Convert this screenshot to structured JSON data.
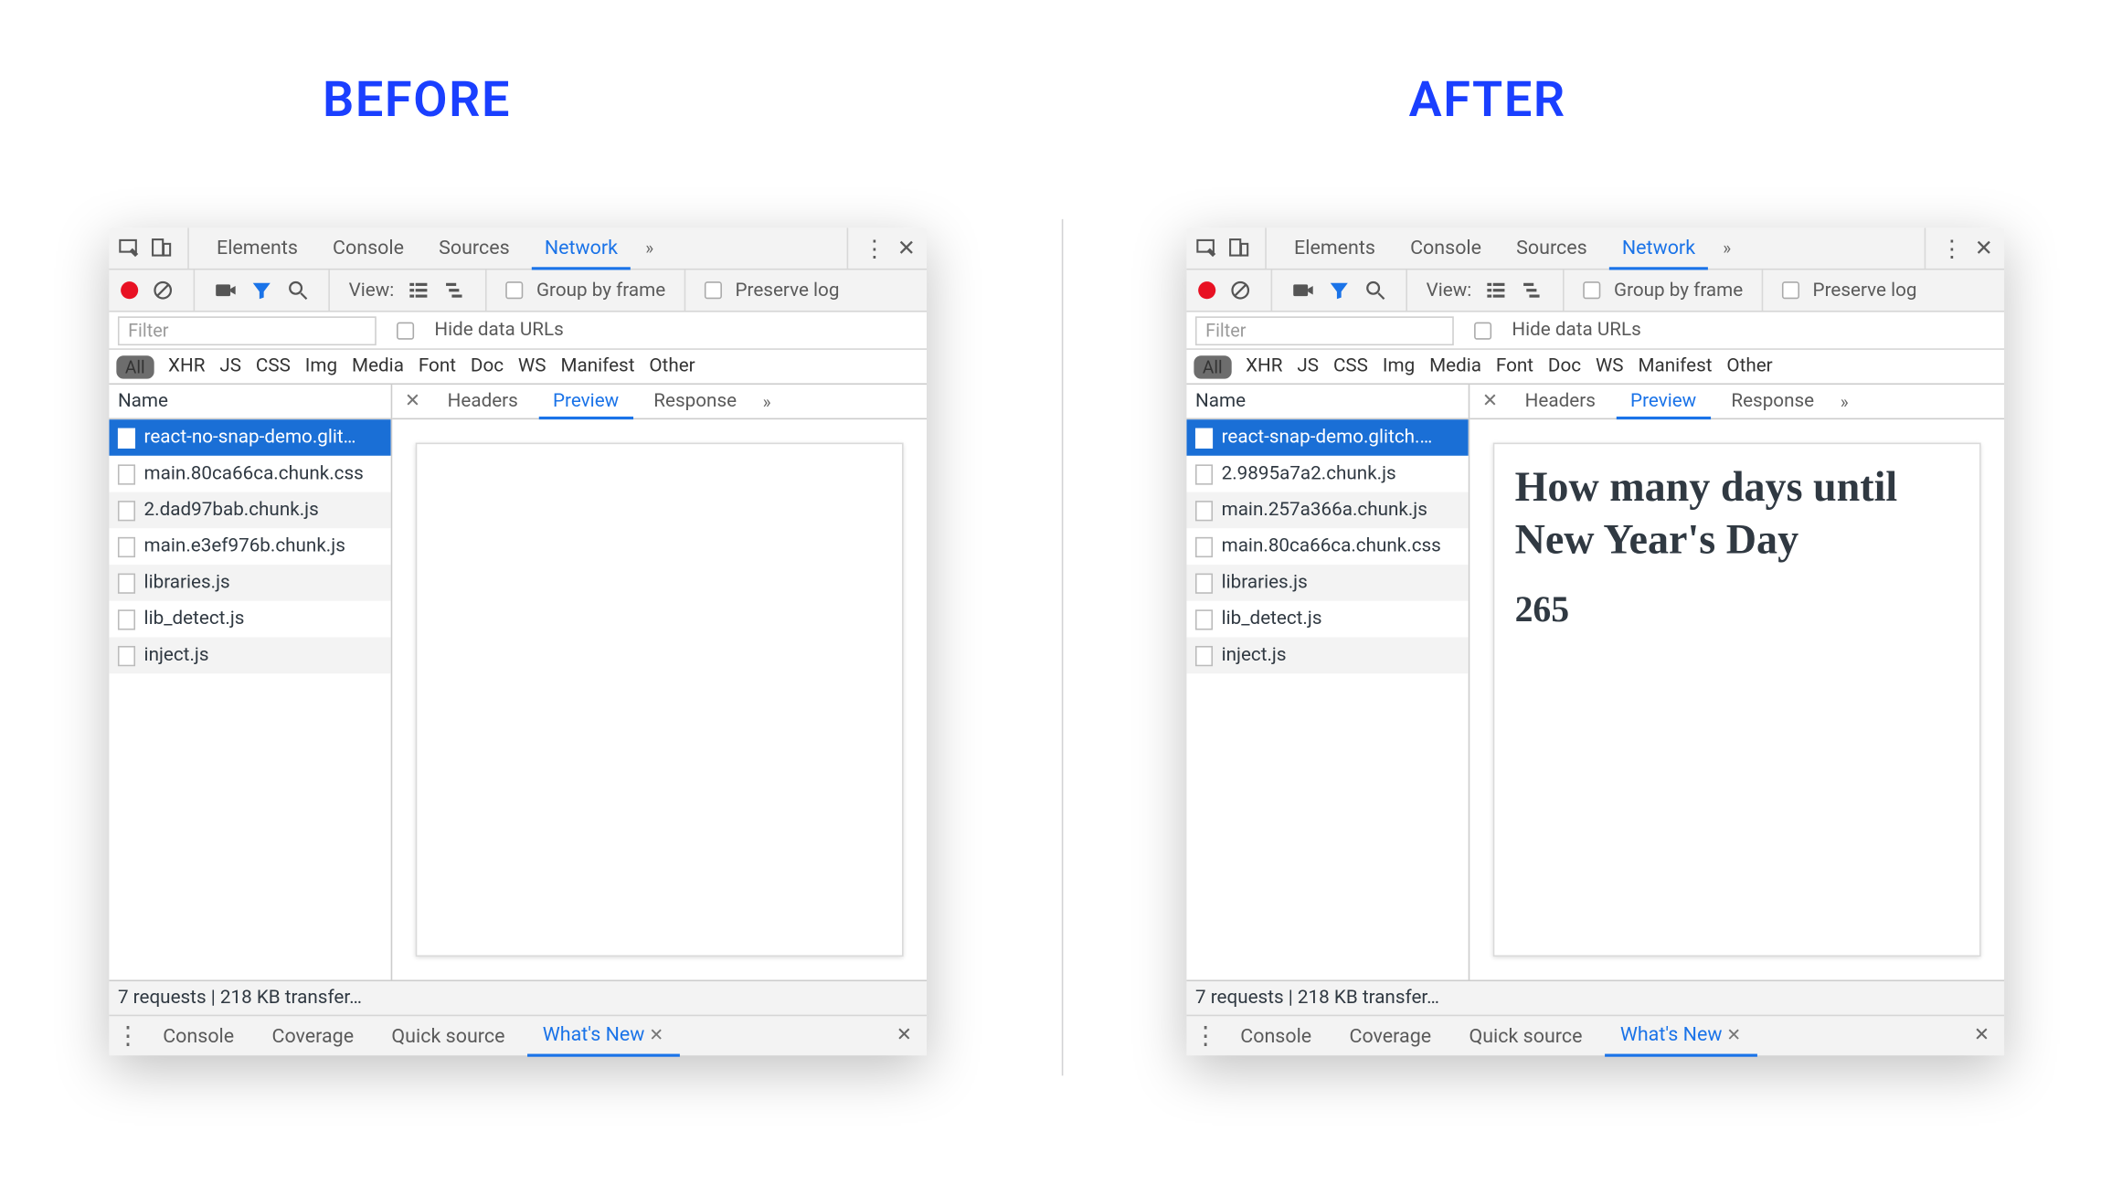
{
  "labels": {
    "before": "BEFORE",
    "after": "AFTER"
  },
  "devtools": {
    "topTabs": {
      "elements": "Elements",
      "console": "Console",
      "sources": "Sources",
      "network": "Network"
    },
    "toolbar": {
      "viewLabel": "View:",
      "groupByFrame": "Group by frame",
      "preserveLog": "Preserve log"
    },
    "filter": {
      "placeholder": "Filter",
      "hideDataUrls": "Hide data URLs"
    },
    "typeFilters": {
      "all": "All",
      "xhr": "XHR",
      "js": "JS",
      "css": "CSS",
      "img": "Img",
      "media": "Media",
      "font": "Font",
      "doc": "Doc",
      "ws": "WS",
      "manifest": "Manifest",
      "other": "Other"
    },
    "listHeader": "Name",
    "detailTabs": {
      "headers": "Headers",
      "preview": "Preview",
      "response": "Response"
    },
    "status": "7 requests | 218 KB transfer…",
    "drawerTabs": {
      "console": "Console",
      "coverage": "Coverage",
      "quick": "Quick source",
      "whatsnew": "What's New"
    }
  },
  "before": {
    "requests": [
      "react-no-snap-demo.glit…",
      "main.80ca66ca.chunk.css",
      "2.dad97bab.chunk.js",
      "main.e3ef976b.chunk.js",
      "libraries.js",
      "lib_detect.js",
      "inject.js"
    ],
    "preview": {
      "heading": "",
      "count": ""
    }
  },
  "after": {
    "requests": [
      "react-snap-demo.glitch.…",
      "2.9895a7a2.chunk.js",
      "main.257a366a.chunk.js",
      "main.80ca66ca.chunk.css",
      "libraries.js",
      "lib_detect.js",
      "inject.js"
    ],
    "preview": {
      "heading": "How many days until New Year's Day",
      "count": "265"
    }
  }
}
